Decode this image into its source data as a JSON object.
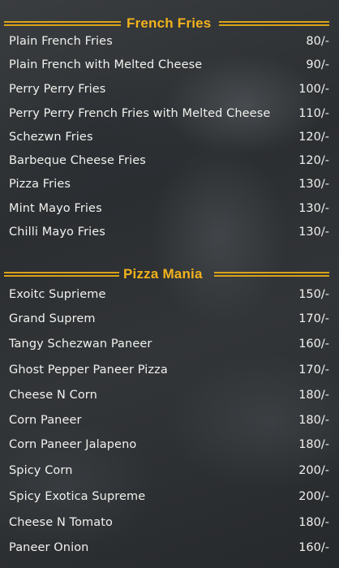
{
  "sections": [
    {
      "title": "French Fries",
      "items": [
        {
          "name": "Plain French Fries",
          "price": "80/-"
        },
        {
          "name": "Plain French with Melted Cheese",
          "price": "90/-"
        },
        {
          "name": "Perry Perry Fries",
          "price": "100/-"
        },
        {
          "name": "Perry Perry French Fries with Melted Cheese",
          "price": "110/-"
        },
        {
          "name": "Schezwn Fries",
          "price": "120/-"
        },
        {
          "name": "Barbeque Cheese Fries",
          "price": "120/-"
        },
        {
          "name": "Pizza Fries",
          "price": "130/-"
        },
        {
          "name": "Mint Mayo Fries",
          "price": "130/-"
        },
        {
          "name": "Chilli Mayo Fries",
          "price": "130/-"
        }
      ]
    },
    {
      "title": "Pizza Mania",
      "items": [
        {
          "name": "Exoitc Suprieme",
          "price": "150/-"
        },
        {
          "name": "Grand Suprem",
          "price": "170/-"
        },
        {
          "name": "Tangy Schezwan Paneer",
          "price": "160/-"
        },
        {
          "name": "Ghost Pepper Paneer Pizza",
          "price": "170/-"
        },
        {
          "name": "Cheese N Corn",
          "price": "180/-"
        },
        {
          "name": "Corn Paneer",
          "price": "180/-"
        },
        {
          "name": "Corn Paneer Jalapeno",
          "price": "180/-"
        },
        {
          "name": "Spicy Corn",
          "price": "200/-"
        },
        {
          "name": "Spicy Exotica Supreme",
          "price": "200/-"
        },
        {
          "name": "Cheese N Tomato",
          "price": "180/-"
        },
        {
          "name": "Paneer Onion",
          "price": "160/-"
        }
      ]
    }
  ],
  "colors": {
    "heading": "#f2b21c",
    "rule": "#d9a21a",
    "text": "#f1f1ee",
    "background": "#2e3134"
  }
}
